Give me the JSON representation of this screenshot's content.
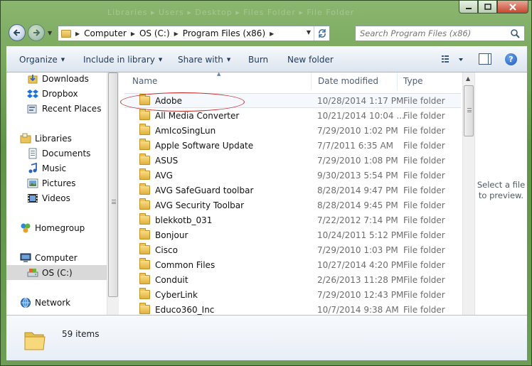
{
  "window": {
    "title_ghost": "Libraries ▸ Users ▸ Desktop ▸ Files Folder ▸ File Folder",
    "min_icon": "minimize-icon",
    "max_icon": "maximize-icon",
    "close_icon": "close-icon"
  },
  "address": {
    "crumbs": [
      "Computer",
      "OS (C:)",
      "Program Files (x86)"
    ],
    "search_placeholder": "Search Program Files (x86)"
  },
  "toolbar": {
    "organize": "Organize",
    "include_in_library": "Include in library",
    "share_with": "Share with",
    "burn": "Burn",
    "new_folder": "New folder",
    "help": "?"
  },
  "nav_pane": {
    "items": [
      {
        "label": "Downloads",
        "icon": "downloads-icon"
      },
      {
        "label": "Dropbox",
        "icon": "dropbox-icon"
      },
      {
        "label": "Recent Places",
        "icon": "recent-places-icon"
      },
      {
        "label": "Libraries",
        "icon": "libraries-icon"
      },
      {
        "label": "Documents",
        "icon": "documents-icon"
      },
      {
        "label": "Music",
        "icon": "music-icon"
      },
      {
        "label": "Pictures",
        "icon": "pictures-icon"
      },
      {
        "label": "Videos",
        "icon": "videos-icon"
      },
      {
        "label": "Homegroup",
        "icon": "homegroup-icon"
      },
      {
        "label": "Computer",
        "icon": "computer-icon"
      },
      {
        "label": "OS (C:)",
        "icon": "drive-icon"
      },
      {
        "label": "Network",
        "icon": "network-icon"
      }
    ]
  },
  "file_list": {
    "columns": {
      "name": "Name",
      "date": "Date modified",
      "type": "Type"
    },
    "rows": [
      {
        "name": "Adobe",
        "date": "10/28/2014 1:17 PM",
        "type": "File folder"
      },
      {
        "name": "All Media Converter",
        "date": "10/21/2014 10:04 ...",
        "type": "File folder"
      },
      {
        "name": "AmIcoSingLun",
        "date": "7/29/2010 1:02 PM",
        "type": "File folder"
      },
      {
        "name": "Apple Software Update",
        "date": "7/7/2011 6:35 AM",
        "type": "File folder"
      },
      {
        "name": "ASUS",
        "date": "7/29/2010 1:08 PM",
        "type": "File folder"
      },
      {
        "name": "AVG",
        "date": "9/30/2013 5:54 PM",
        "type": "File folder"
      },
      {
        "name": "AVG SafeGuard toolbar",
        "date": "8/28/2014 9:47 PM",
        "type": "File folder"
      },
      {
        "name": "AVG Security Toolbar",
        "date": "8/28/2014 9:45 PM",
        "type": "File folder"
      },
      {
        "name": "blekkotb_031",
        "date": "7/22/2012 7:14 PM",
        "type": "File folder"
      },
      {
        "name": "Bonjour",
        "date": "10/24/2011 5:12 PM",
        "type": "File folder"
      },
      {
        "name": "Cisco",
        "date": "7/29/2010 1:03 PM",
        "type": "File folder"
      },
      {
        "name": "Common Files",
        "date": "10/27/2014 4:20 PM",
        "type": "File folder"
      },
      {
        "name": "Conduit",
        "date": "2/26/2013 11:28 PM",
        "type": "File folder"
      },
      {
        "name": "CyberLink",
        "date": "7/29/2010 12:43 PM",
        "type": "File folder"
      },
      {
        "name": "Educo360_Inc",
        "date": "10/7/2014 9:38 AM",
        "type": "File folder"
      }
    ]
  },
  "preview": {
    "text": "Select a file to preview."
  },
  "details": {
    "count": "59 items"
  }
}
